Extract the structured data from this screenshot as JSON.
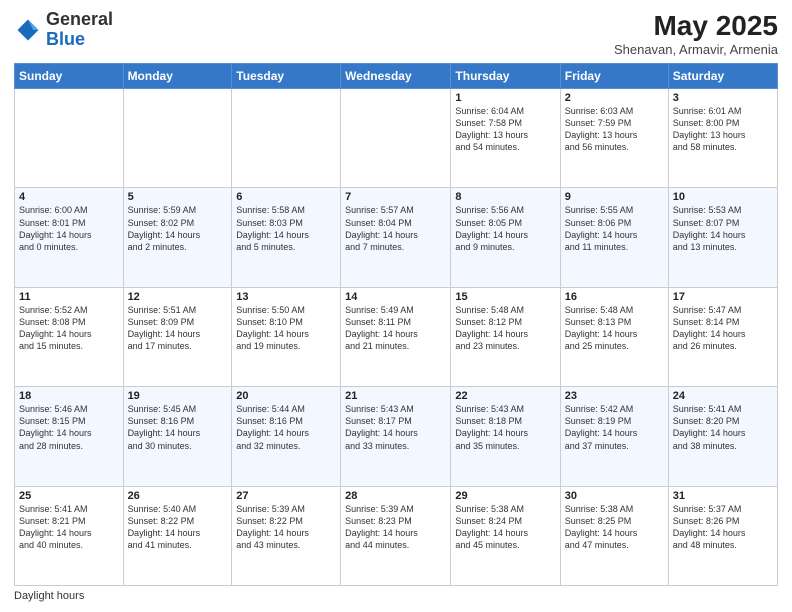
{
  "header": {
    "logo_general": "General",
    "logo_blue": "Blue",
    "month_year": "May 2025",
    "location": "Shenavan, Armavir, Armenia"
  },
  "days_of_week": [
    "Sunday",
    "Monday",
    "Tuesday",
    "Wednesday",
    "Thursday",
    "Friday",
    "Saturday"
  ],
  "weeks": [
    [
      {
        "day": "",
        "info": ""
      },
      {
        "day": "",
        "info": ""
      },
      {
        "day": "",
        "info": ""
      },
      {
        "day": "",
        "info": ""
      },
      {
        "day": "1",
        "info": "Sunrise: 6:04 AM\nSunset: 7:58 PM\nDaylight: 13 hours\nand 54 minutes."
      },
      {
        "day": "2",
        "info": "Sunrise: 6:03 AM\nSunset: 7:59 PM\nDaylight: 13 hours\nand 56 minutes."
      },
      {
        "day": "3",
        "info": "Sunrise: 6:01 AM\nSunset: 8:00 PM\nDaylight: 13 hours\nand 58 minutes."
      }
    ],
    [
      {
        "day": "4",
        "info": "Sunrise: 6:00 AM\nSunset: 8:01 PM\nDaylight: 14 hours\nand 0 minutes."
      },
      {
        "day": "5",
        "info": "Sunrise: 5:59 AM\nSunset: 8:02 PM\nDaylight: 14 hours\nand 2 minutes."
      },
      {
        "day": "6",
        "info": "Sunrise: 5:58 AM\nSunset: 8:03 PM\nDaylight: 14 hours\nand 5 minutes."
      },
      {
        "day": "7",
        "info": "Sunrise: 5:57 AM\nSunset: 8:04 PM\nDaylight: 14 hours\nand 7 minutes."
      },
      {
        "day": "8",
        "info": "Sunrise: 5:56 AM\nSunset: 8:05 PM\nDaylight: 14 hours\nand 9 minutes."
      },
      {
        "day": "9",
        "info": "Sunrise: 5:55 AM\nSunset: 8:06 PM\nDaylight: 14 hours\nand 11 minutes."
      },
      {
        "day": "10",
        "info": "Sunrise: 5:53 AM\nSunset: 8:07 PM\nDaylight: 14 hours\nand 13 minutes."
      }
    ],
    [
      {
        "day": "11",
        "info": "Sunrise: 5:52 AM\nSunset: 8:08 PM\nDaylight: 14 hours\nand 15 minutes."
      },
      {
        "day": "12",
        "info": "Sunrise: 5:51 AM\nSunset: 8:09 PM\nDaylight: 14 hours\nand 17 minutes."
      },
      {
        "day": "13",
        "info": "Sunrise: 5:50 AM\nSunset: 8:10 PM\nDaylight: 14 hours\nand 19 minutes."
      },
      {
        "day": "14",
        "info": "Sunrise: 5:49 AM\nSunset: 8:11 PM\nDaylight: 14 hours\nand 21 minutes."
      },
      {
        "day": "15",
        "info": "Sunrise: 5:48 AM\nSunset: 8:12 PM\nDaylight: 14 hours\nand 23 minutes."
      },
      {
        "day": "16",
        "info": "Sunrise: 5:48 AM\nSunset: 8:13 PM\nDaylight: 14 hours\nand 25 minutes."
      },
      {
        "day": "17",
        "info": "Sunrise: 5:47 AM\nSunset: 8:14 PM\nDaylight: 14 hours\nand 26 minutes."
      }
    ],
    [
      {
        "day": "18",
        "info": "Sunrise: 5:46 AM\nSunset: 8:15 PM\nDaylight: 14 hours\nand 28 minutes."
      },
      {
        "day": "19",
        "info": "Sunrise: 5:45 AM\nSunset: 8:16 PM\nDaylight: 14 hours\nand 30 minutes."
      },
      {
        "day": "20",
        "info": "Sunrise: 5:44 AM\nSunset: 8:16 PM\nDaylight: 14 hours\nand 32 minutes."
      },
      {
        "day": "21",
        "info": "Sunrise: 5:43 AM\nSunset: 8:17 PM\nDaylight: 14 hours\nand 33 minutes."
      },
      {
        "day": "22",
        "info": "Sunrise: 5:43 AM\nSunset: 8:18 PM\nDaylight: 14 hours\nand 35 minutes."
      },
      {
        "day": "23",
        "info": "Sunrise: 5:42 AM\nSunset: 8:19 PM\nDaylight: 14 hours\nand 37 minutes."
      },
      {
        "day": "24",
        "info": "Sunrise: 5:41 AM\nSunset: 8:20 PM\nDaylight: 14 hours\nand 38 minutes."
      }
    ],
    [
      {
        "day": "25",
        "info": "Sunrise: 5:41 AM\nSunset: 8:21 PM\nDaylight: 14 hours\nand 40 minutes."
      },
      {
        "day": "26",
        "info": "Sunrise: 5:40 AM\nSunset: 8:22 PM\nDaylight: 14 hours\nand 41 minutes."
      },
      {
        "day": "27",
        "info": "Sunrise: 5:39 AM\nSunset: 8:22 PM\nDaylight: 14 hours\nand 43 minutes."
      },
      {
        "day": "28",
        "info": "Sunrise: 5:39 AM\nSunset: 8:23 PM\nDaylight: 14 hours\nand 44 minutes."
      },
      {
        "day": "29",
        "info": "Sunrise: 5:38 AM\nSunset: 8:24 PM\nDaylight: 14 hours\nand 45 minutes."
      },
      {
        "day": "30",
        "info": "Sunrise: 5:38 AM\nSunset: 8:25 PM\nDaylight: 14 hours\nand 47 minutes."
      },
      {
        "day": "31",
        "info": "Sunrise: 5:37 AM\nSunset: 8:26 PM\nDaylight: 14 hours\nand 48 minutes."
      }
    ]
  ],
  "footer": {
    "daylight_label": "Daylight hours"
  }
}
